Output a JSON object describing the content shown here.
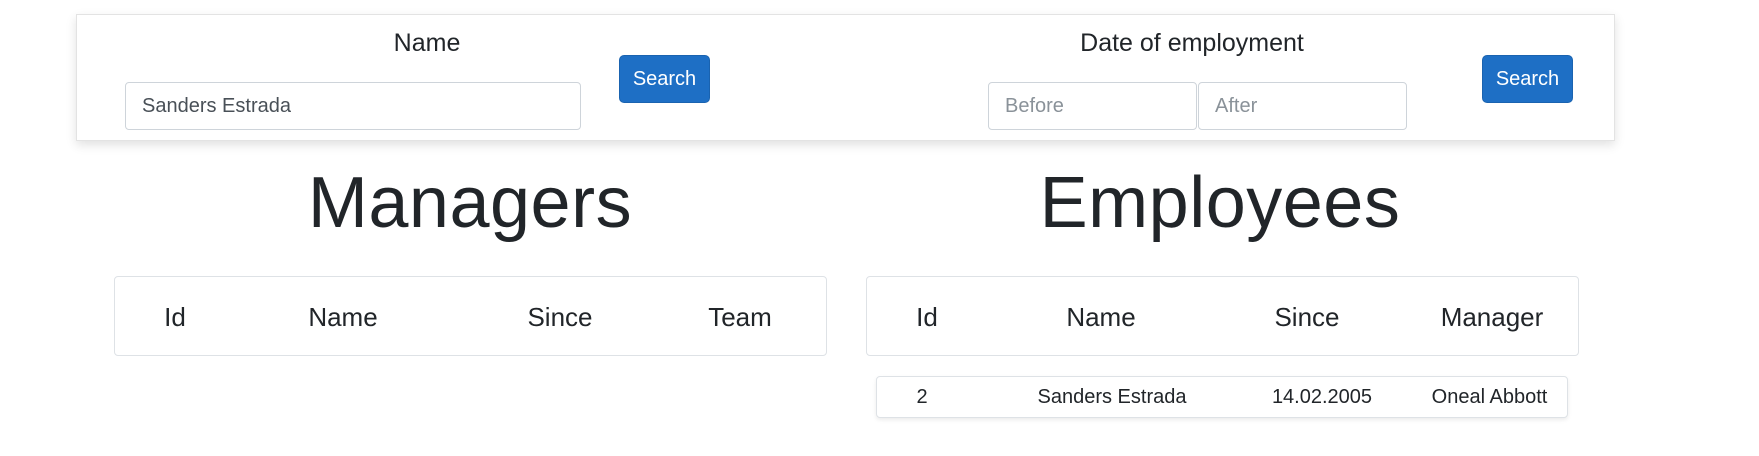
{
  "search": {
    "name_label": "Name",
    "name_value": "Sanders Estrada",
    "name_button": "Search",
    "date_label": "Date of employment",
    "before_placeholder": "Before",
    "after_placeholder": "After",
    "date_button": "Search"
  },
  "managers": {
    "title": "Managers",
    "columns": [
      "Id",
      "Name",
      "Since",
      "Team"
    ],
    "rows": []
  },
  "employees": {
    "title": "Employees",
    "columns": [
      "Id",
      "Name",
      "Since",
      "Manager"
    ],
    "rows": [
      [
        "2",
        "Sanders Estrada",
        "14.02.2005",
        "Oneal Abbott"
      ]
    ]
  },
  "colors": {
    "primary_button": "#1e6fc5",
    "border": "#dee2e6"
  }
}
